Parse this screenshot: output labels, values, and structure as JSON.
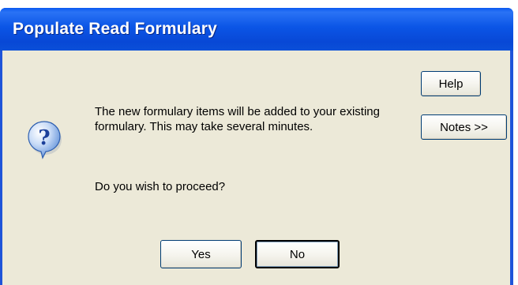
{
  "window": {
    "title": "Populate Read Formulary"
  },
  "dialog": {
    "message": "The new formulary items will be added to your existing formulary. This may take several minutes.",
    "question": "Do you wish to proceed?",
    "icon": "question-icon"
  },
  "buttons": {
    "help": "Help",
    "notes": "Notes >>",
    "yes": "Yes",
    "no": "No"
  },
  "colors": {
    "titlebar": "#0b55e6",
    "client_background": "#ece9d8",
    "button_border": "#003c74"
  }
}
